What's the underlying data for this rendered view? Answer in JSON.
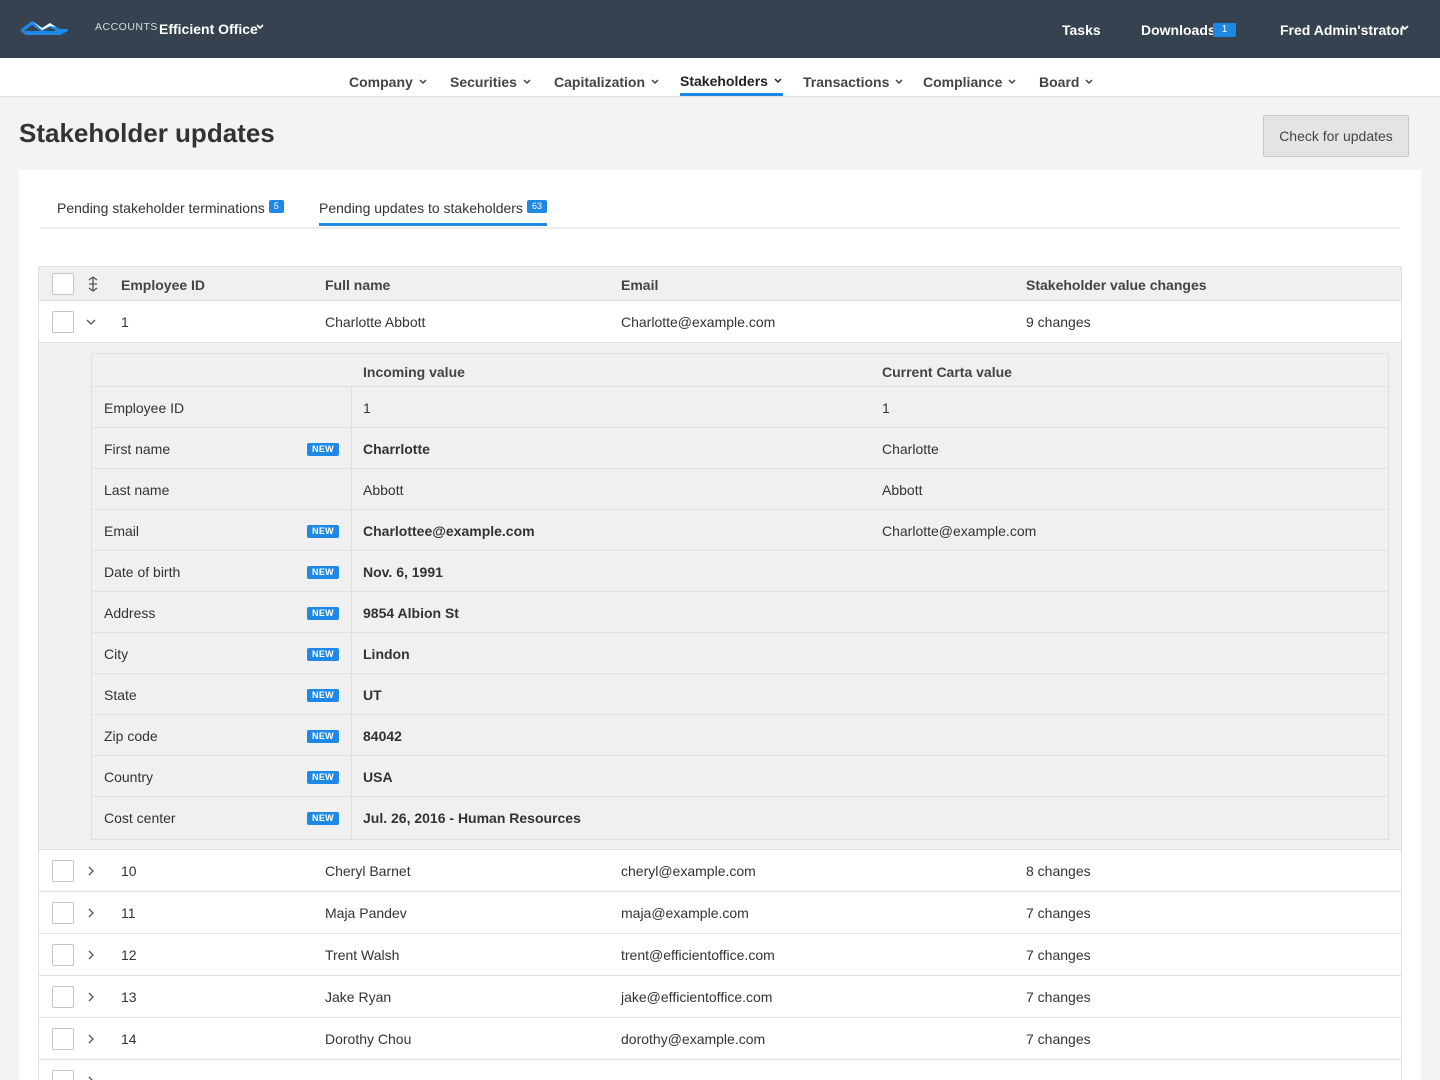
{
  "topbar": {
    "account_label": "ACCOUNTS",
    "org_name": "Efficient Office",
    "tasks": "Tasks",
    "downloads": "Downloads",
    "downloads_count": "1",
    "user": "Fred Admin'strator"
  },
  "subnav": [
    "Company",
    "Securities",
    "Capitalization",
    "Stakeholders",
    "Transactions",
    "Compliance",
    "Board"
  ],
  "subnav_active": "Stakeholders",
  "page": {
    "title": "Stakeholder updates",
    "check_button": "Check for updates"
  },
  "tabs": [
    {
      "label": "Pending stakeholder terminations",
      "count": "5"
    },
    {
      "label": "Pending updates to stakeholders",
      "count": "63",
      "active": true
    }
  ],
  "table": {
    "headers": {
      "employee_id": "Employee ID",
      "full_name": "Full name",
      "email": "Email",
      "changes": "Stakeholder value changes"
    },
    "expanded_row": {
      "id": "1",
      "name": "Charlotte Abbott",
      "email": "Charlotte@example.com",
      "changes": "9 changes"
    },
    "detail": {
      "headers": {
        "incoming": "Incoming value",
        "current": "Current Carta value"
      },
      "new_label": "NEW",
      "rows": [
        {
          "label": "Employee ID",
          "incoming": "1",
          "current": "1",
          "is_new": false
        },
        {
          "label": "First name",
          "incoming": "Charrlotte",
          "current": "Charlotte",
          "is_new": true
        },
        {
          "label": "Last name",
          "incoming": "Abbott",
          "current": "Abbott",
          "is_new": false
        },
        {
          "label": "Email",
          "incoming": "Charlottee@example.com",
          "current": "Charlotte@example.com",
          "is_new": true
        },
        {
          "label": "Date of birth",
          "incoming": "Nov. 6, 1991",
          "current": "",
          "is_new": true
        },
        {
          "label": "Address",
          "incoming": "9854 Albion St",
          "current": "",
          "is_new": true
        },
        {
          "label": "City",
          "incoming": "Lindon",
          "current": "",
          "is_new": true
        },
        {
          "label": "State",
          "incoming": "UT",
          "current": "",
          "is_new": true
        },
        {
          "label": "Zip code",
          "incoming": "84042",
          "current": "",
          "is_new": true
        },
        {
          "label": "Country",
          "incoming": "USA",
          "current": "",
          "is_new": true
        },
        {
          "label": "Cost center",
          "incoming": "Jul. 26, 2016 - Human Resources",
          "current": "",
          "is_new": true
        }
      ]
    },
    "rows": [
      {
        "id": "10",
        "name": "Cheryl Barnet",
        "email": "cheryl@example.com",
        "changes": "8 changes"
      },
      {
        "id": "11",
        "name": "Maja Pandev",
        "email": "maja@example.com",
        "changes": "7 changes"
      },
      {
        "id": "12",
        "name": "Trent Walsh",
        "email": "trent@efficientoffice.com",
        "changes": "7 changes"
      },
      {
        "id": "13",
        "name": "Jake Ryan",
        "email": "jake@efficientoffice.com",
        "changes": "7 changes"
      },
      {
        "id": "14",
        "name": "Dorothy Chou",
        "email": "dorothy@example.com",
        "changes": "7 changes"
      }
    ]
  },
  "colors": {
    "topbar": "#364250",
    "accent": "#1e88e5"
  }
}
